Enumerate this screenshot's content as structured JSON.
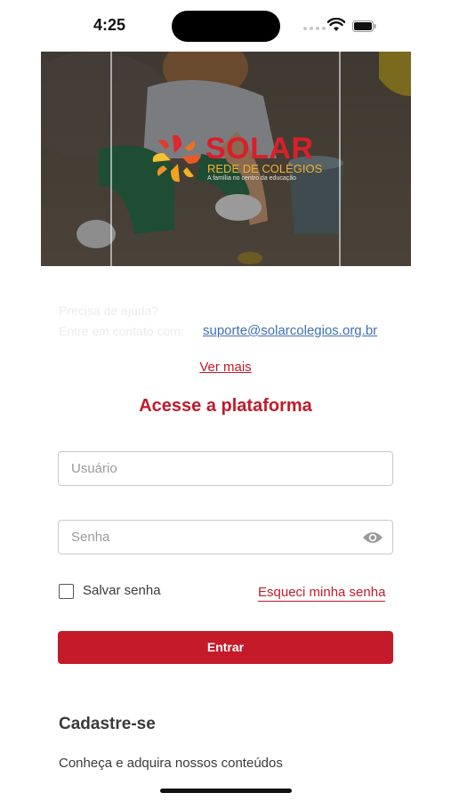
{
  "status_bar": {
    "time": "4:25"
  },
  "hero": {
    "logo": {
      "name": "SOLAR",
      "subtitle": "REDE DE COLÉGIOS",
      "tagline": "A família no centro da educação"
    }
  },
  "help": {
    "title": "Precisa de ajuda?",
    "text": "Entre em contato com:",
    "email": "suporte@solarcolegios.org.br",
    "see_more": "Ver mais"
  },
  "login": {
    "heading": "Acesse a plataforma",
    "username_placeholder": "Usuário",
    "password_placeholder": "Senha",
    "save_password_label": "Salvar senha",
    "forgot_password": "Esqueci minha senha",
    "submit_label": "Entrar"
  },
  "register": {
    "title": "Cadastre-se",
    "subtitle": "Conheça e adquira nossos conteúdos"
  },
  "colors": {
    "brand_red": "#c41a2a",
    "link_blue": "#3d6fb5",
    "logo_orange": "#f2b12e"
  },
  "icons": [
    "wifi-icon",
    "battery-icon",
    "eye-icon",
    "logo-mark-icon"
  ]
}
